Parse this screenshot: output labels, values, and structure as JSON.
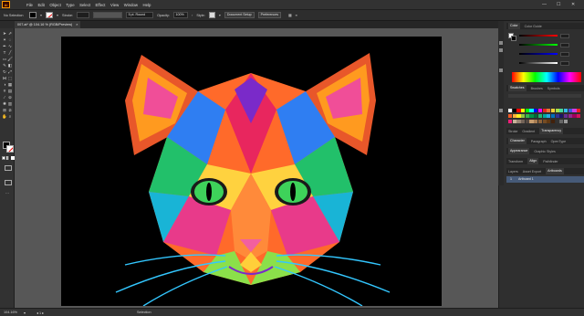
{
  "app": {
    "logo": "Ai"
  },
  "menu": [
    "File",
    "Edit",
    "Object",
    "Type",
    "Select",
    "Effect",
    "View",
    "Window",
    "Help"
  ],
  "window_controls": [
    "—",
    "☐",
    "✕"
  ],
  "control_bar": {
    "selection_state": "No Selection",
    "stroke_label": "Stroke:",
    "brush_value": "5 pt. Round",
    "opacity_label": "Opacity:",
    "opacity_value": "100%",
    "style_label": "Style:",
    "document_setup": "Document Setup",
    "preferences": "Preferences"
  },
  "document_tab": {
    "title": "007.ai* @ 104.16 % (RGB/Preview)",
    "close": "×"
  },
  "panels": {
    "color_tabs": [
      "Color",
      "Color Guide"
    ],
    "swatch_tabs": [
      "Swatches",
      "Brushes",
      "Symbols"
    ],
    "stroke_tabs": [
      "Stroke",
      "Gradient",
      "Transparency"
    ],
    "char_tabs": [
      "Character",
      "Paragraph",
      "OpenType"
    ],
    "appearance_tabs": [
      "Appearance",
      "Graphic Styles"
    ],
    "transform_tabs": [
      "Transform",
      "Align",
      "Pathfinder"
    ],
    "layers_tabs": [
      "Layers",
      "Asset Export",
      "Artboards"
    ],
    "artboard_row": {
      "index": "1",
      "name": "Artboard 1"
    }
  },
  "status_bar": {
    "zoom": "104.16%",
    "mode": "Selection"
  },
  "colors": {
    "menubar": "#323232",
    "canvas": "#575757",
    "artboard": "#000000",
    "accent": "#465a78"
  },
  "swatch_colors": [
    "#ffffff",
    "#000000",
    "#ff0000",
    "#ffff00",
    "#00ff00",
    "#00ffff",
    "#0000ff",
    "#ff00ff",
    "#e6261f",
    "#eb7532",
    "#f7d038",
    "#a3e048",
    "#49da9a",
    "#34bbe6",
    "#4355db",
    "#d23be7",
    "#ed1c24",
    "#f15a24",
    "#fbb03b",
    "#fcee21",
    "#8cc63f",
    "#39b54a",
    "#009245",
    "#006837",
    "#22b573",
    "#00a99d",
    "#29abe2",
    "#0071bc",
    "#2e3192",
    "#1b1464",
    "#662d91",
    "#93278f",
    "#9e005d",
    "#d4145a",
    "#ed1e79",
    "#c7b299",
    "#998675",
    "#736357",
    "#534741",
    "#c69c6d",
    "#a67c52",
    "#8c6239",
    "#754c24",
    "#603813",
    "#42210b",
    "#333333",
    "#666666",
    "#999999"
  ]
}
